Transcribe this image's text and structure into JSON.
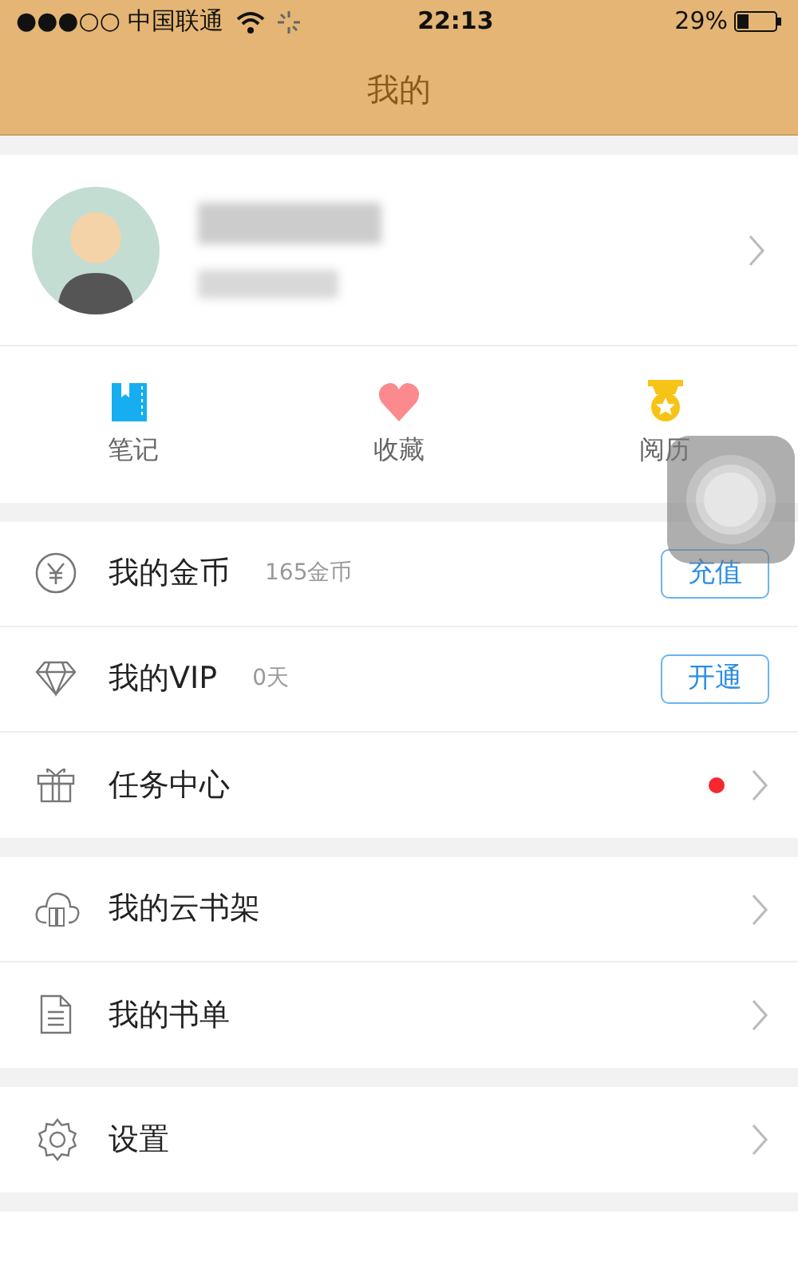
{
  "status_bar": {
    "carrier": "●●●○○ 中国联通",
    "time": "22:13",
    "battery": "29%"
  },
  "nav_bar": {
    "title": "我的"
  },
  "shortcuts": [
    {
      "label": "笔记",
      "kind": "notebook"
    },
    {
      "label": "收藏",
      "kind": "heart"
    },
    {
      "label": "阅历",
      "kind": "medal"
    }
  ],
  "menu_groups": [
    [
      {
        "label": "我的金币",
        "kind": "yuan",
        "detail": "165金币",
        "action": "充值"
      },
      {
        "label": "我的VIP",
        "kind": "diamond",
        "detail": "0天",
        "action": "开通"
      },
      {
        "label": "任务中心",
        "kind": "gift",
        "color": "#f5282e"
      }
    ],
    [
      {
        "label": "我的云书架",
        "kind": "cloud"
      },
      {
        "label": "我的书单",
        "kind": "document"
      }
    ],
    [
      {
        "label": "设置",
        "kind": "gear"
      }
    ]
  ]
}
